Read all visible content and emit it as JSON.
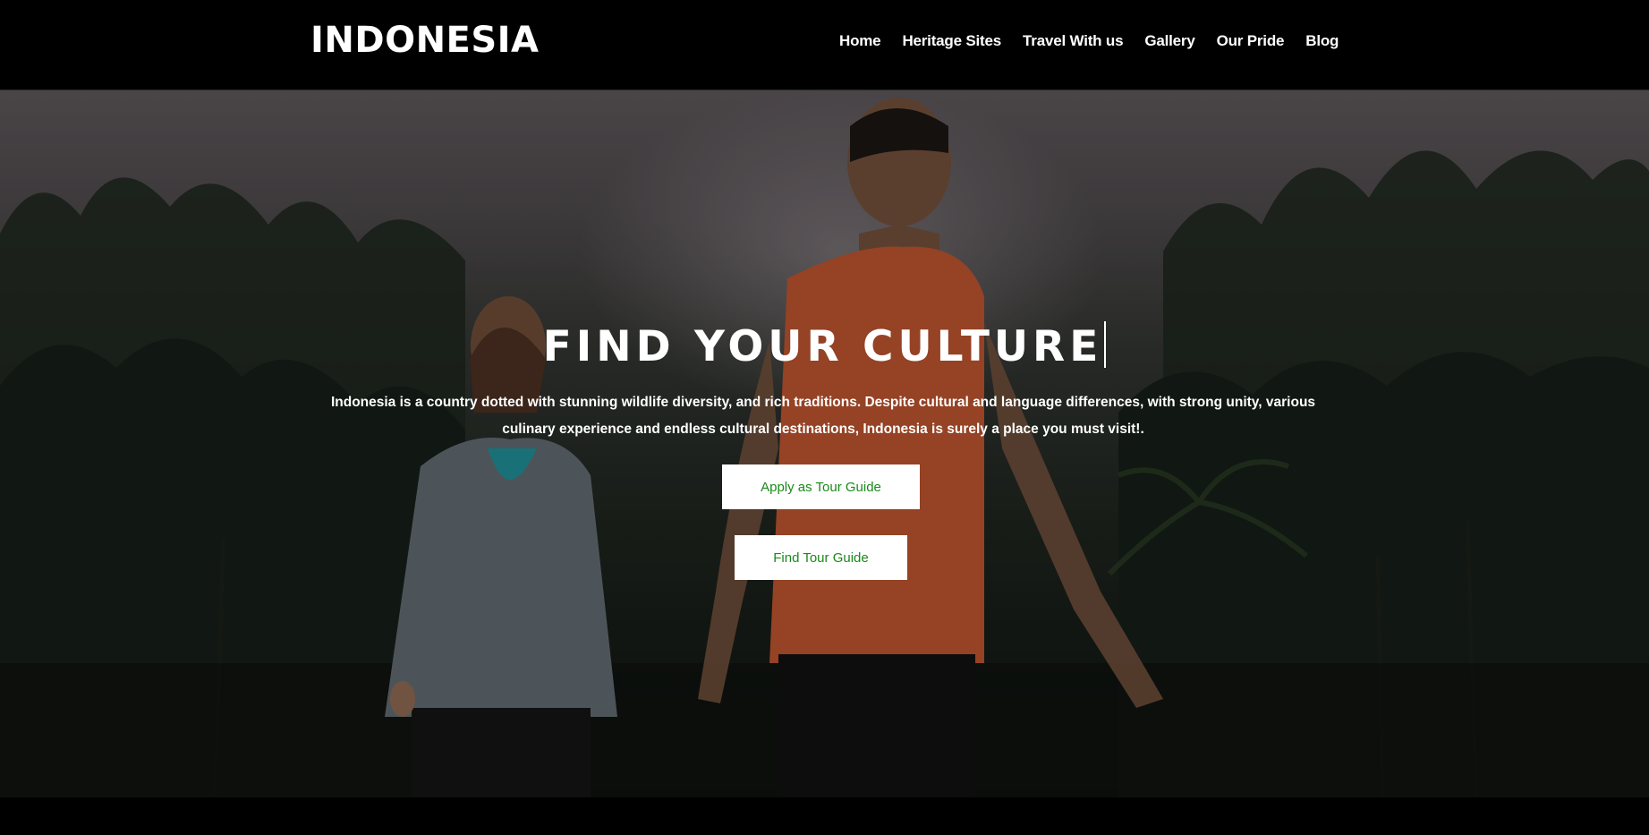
{
  "navbar": {
    "brand": "INDONESIA",
    "links": [
      "Home",
      "Heritage Sites",
      "Travel With us",
      "Gallery",
      "Our Pride",
      "Blog"
    ]
  },
  "hero": {
    "title": "FIND YOUR CULTURE",
    "description": "Indonesia is a country dotted with stunning wildlife diversity, and rich traditions. Despite cultural and language differences, with strong unity, various culinary experience and endless cultural destinations, Indonesia is surely a place you must visit!.",
    "apply_button": "Apply as Tour Guide",
    "find_button": "Find Tour Guide",
    "image_description": "man in orange shirt and woman in grey hoodie walking through tropical forest"
  },
  "colors": {
    "navbar_bg": "#000000",
    "button_bg": "#ffffff",
    "button_text": "#1a8a1a",
    "text": "#ffffff"
  }
}
